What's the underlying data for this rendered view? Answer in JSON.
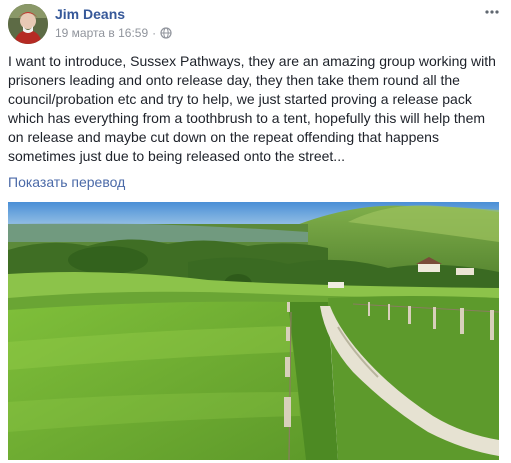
{
  "post": {
    "author": "Jim Deans",
    "timestamp": "19 марта в 16:59",
    "separator": "·",
    "privacy_icon": "globe-icon",
    "more_icon": "more-horizontal-icon",
    "text_lines": [
      "I want to introduce, Sussex Pathways, they are an amazing group working with",
      "prisoners leading and onto release day, they then take them round all the",
      "council/probation etc and try to help, we just started proving a release pack",
      "which has everything from a toothbrush to a tent, hopefully this will help them",
      "on release and maybe cut down on the repeat offending that happens",
      "sometimes just due to being released onto the street..."
    ],
    "translate_link": "Показать перевод"
  },
  "colors": {
    "author_blue": "#365899",
    "link_blue": "#4b6aa8",
    "meta_gray": "#90949c",
    "text": "#1d2129"
  }
}
